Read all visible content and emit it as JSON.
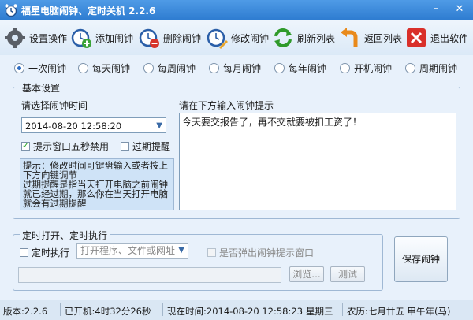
{
  "window": {
    "title": "福星电脑闹钟、定时关机 2.2.6"
  },
  "toolbar": {
    "items": [
      {
        "label": "设置操作",
        "icon": "gear-icon"
      },
      {
        "label": "添加闹钟",
        "icon": "alarm-add-icon"
      },
      {
        "label": "删除闹钟",
        "icon": "alarm-delete-icon"
      },
      {
        "label": "修改闹钟",
        "icon": "alarm-edit-icon"
      },
      {
        "label": "刷新列表",
        "icon": "refresh-icon"
      },
      {
        "label": "返回列表",
        "icon": "return-icon"
      },
      {
        "label": "退出软件",
        "icon": "exit-icon"
      }
    ]
  },
  "repeat_modes": {
    "selected": "一次闹钟",
    "options": [
      "一次闹钟",
      "每天闹钟",
      "每周闹钟",
      "每月闹钟",
      "每年闹钟",
      "开机闹钟",
      "周期闹钟"
    ]
  },
  "basic": {
    "group_title": "基本设置",
    "time_label": "请选择闹钟时间",
    "time_value": "2014-08-20  12:58:20",
    "popup_ban_label": "提示窗口五秒禁用",
    "popup_ban_checked": true,
    "overdue_label": "过期提醒",
    "overdue_checked": false,
    "tip_lines": [
      "提示：修改时间可键盘输入或者按上下方向键调节",
      "过期提醒是指当天打开电脑之前闹钟就已经过期，那么你在当天打开电脑就会有过期提醒"
    ],
    "message_label": "请在下方输入闹钟提示",
    "message_value": "今天要交报告了，再不交就要被扣工资了！"
  },
  "timed_exec": {
    "group_title": "定时打开、定时执行",
    "enable_label": "定时执行",
    "combo_placeholder": "打开程序、文件或网址",
    "popup_label": "是否弹出闹钟提示窗口",
    "browse_label": "浏览...",
    "test_label": "测试"
  },
  "save_label": "保存闹钟",
  "status": {
    "version": "版本:2.2.6",
    "uptime": "已开机:4时32分26秒",
    "now": "现在时间:2014-08-20 12:58:23",
    "weekday": "星期三",
    "lunar": "农历:七月廿五  甲午年(马)"
  },
  "colors": {
    "titlebar": "#2d7bd0",
    "window_bg": "#e8f1fb",
    "accent": "#2b6bc2"
  }
}
